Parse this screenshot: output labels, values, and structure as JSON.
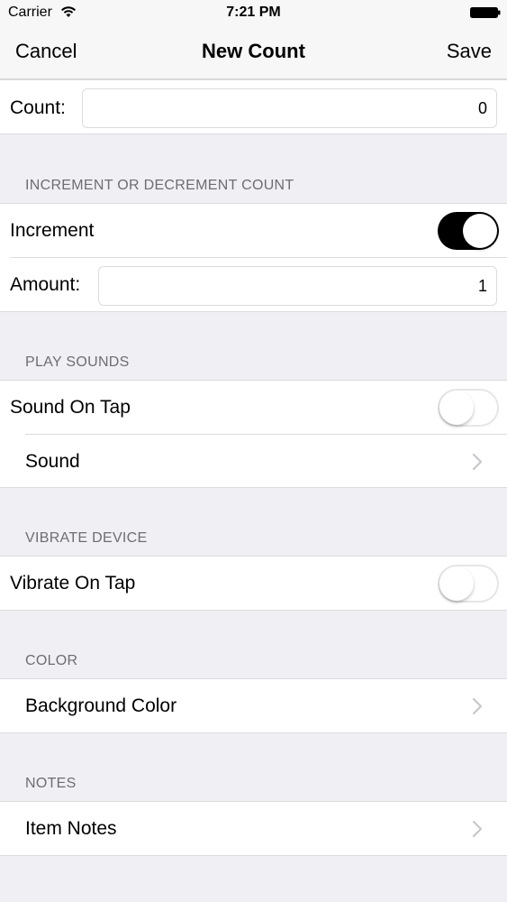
{
  "status_bar": {
    "carrier": "Carrier",
    "time": "7:21 PM"
  },
  "nav": {
    "cancel": "Cancel",
    "title": "New Count",
    "save": "Save"
  },
  "count": {
    "label": "Count:",
    "value": "0"
  },
  "increment_section": {
    "header": "INCREMENT OR DECREMENT COUNT",
    "toggle_label": "Increment",
    "toggle_on": true,
    "amount_label": "Amount:",
    "amount_value": "1"
  },
  "sounds_section": {
    "header": "PLAY SOUNDS",
    "toggle_label": "Sound On Tap",
    "toggle_on": false,
    "sound_label": "Sound"
  },
  "vibrate_section": {
    "header": "VIBRATE DEVICE",
    "toggle_label": "Vibrate On Tap",
    "toggle_on": false
  },
  "color_section": {
    "header": "COLOR",
    "item_label": "Background Color"
  },
  "notes_section": {
    "header": "NOTES",
    "item_label": "Item Notes"
  },
  "colors": {
    "toggle_on": "#000000",
    "background": "#efeff4",
    "header_text": "#6d6d72"
  }
}
